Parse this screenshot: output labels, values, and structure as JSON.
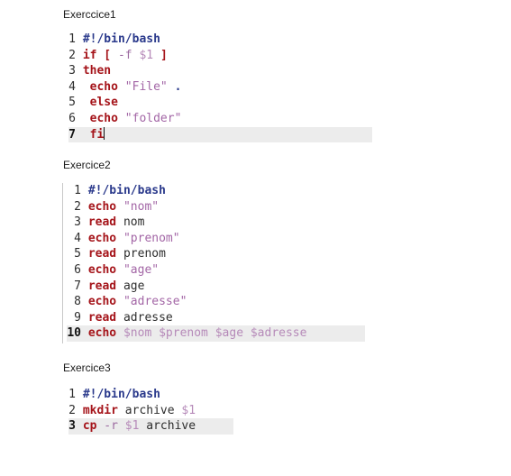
{
  "ex1": {
    "title": "Exerccice1",
    "lines": [
      {
        "n": "1",
        "tokens": [
          {
            "t": "she",
            "v": "#!/bin/bash"
          }
        ]
      },
      {
        "n": "2",
        "tokens": [
          {
            "t": "kw",
            "v": "if ["
          },
          {
            "t": "opt",
            "v": " -f "
          },
          {
            "t": "var",
            "v": "$1 "
          },
          {
            "t": "kw",
            "v": "]"
          }
        ]
      },
      {
        "n": "3",
        "tokens": [
          {
            "t": "kw",
            "v": "then"
          }
        ]
      },
      {
        "n": "4",
        "tokens": [
          {
            "t": "txt",
            "v": " "
          },
          {
            "t": "kw",
            "v": "echo"
          },
          {
            "t": "txt",
            "v": " "
          },
          {
            "t": "str",
            "v": "\"File\""
          },
          {
            "t": "txt",
            "v": " "
          },
          {
            "t": "dot",
            "v": "."
          }
        ]
      },
      {
        "n": "5",
        "tokens": [
          {
            "t": "txt",
            "v": " "
          },
          {
            "t": "kw",
            "v": "else"
          }
        ]
      },
      {
        "n": "6",
        "tokens": [
          {
            "t": "txt",
            "v": " "
          },
          {
            "t": "kw",
            "v": "echo"
          },
          {
            "t": "txt",
            "v": " "
          },
          {
            "t": "str",
            "v": "\"folder\""
          }
        ]
      },
      {
        "n": "7",
        "tokens": [
          {
            "t": "txt",
            "v": " "
          },
          {
            "t": "kw",
            "v": "fi"
          }
        ],
        "current": true,
        "caret": true
      }
    ]
  },
  "ex2": {
    "title": "Exercice2",
    "lines": [
      {
        "n": "1",
        "tokens": [
          {
            "t": "she",
            "v": "#!/bin/bash"
          }
        ]
      },
      {
        "n": "2",
        "tokens": [
          {
            "t": "kw",
            "v": "echo"
          },
          {
            "t": "txt",
            "v": " "
          },
          {
            "t": "str",
            "v": "\"nom\""
          }
        ]
      },
      {
        "n": "3",
        "tokens": [
          {
            "t": "kw",
            "v": "read"
          },
          {
            "t": "txt",
            "v": " nom"
          }
        ]
      },
      {
        "n": "4",
        "tokens": [
          {
            "t": "kw",
            "v": "echo"
          },
          {
            "t": "txt",
            "v": " "
          },
          {
            "t": "str",
            "v": "\"prenom\""
          }
        ]
      },
      {
        "n": "5",
        "tokens": [
          {
            "t": "kw",
            "v": "read"
          },
          {
            "t": "txt",
            "v": " prenom"
          }
        ]
      },
      {
        "n": "6",
        "tokens": [
          {
            "t": "kw",
            "v": "echo"
          },
          {
            "t": "txt",
            "v": " "
          },
          {
            "t": "str",
            "v": "\"age\""
          }
        ]
      },
      {
        "n": "7",
        "tokens": [
          {
            "t": "kw",
            "v": "read"
          },
          {
            "t": "txt",
            "v": " age"
          }
        ]
      },
      {
        "n": "8",
        "tokens": [
          {
            "t": "kw",
            "v": "echo"
          },
          {
            "t": "txt",
            "v": " "
          },
          {
            "t": "str",
            "v": "\"adresse\""
          }
        ]
      },
      {
        "n": "9",
        "tokens": [
          {
            "t": "kw",
            "v": "read"
          },
          {
            "t": "txt",
            "v": " adresse"
          }
        ]
      },
      {
        "n": "10",
        "tokens": [
          {
            "t": "kw",
            "v": "echo"
          },
          {
            "t": "txt",
            "v": " "
          },
          {
            "t": "var",
            "v": "$nom $prenom $age $adresse"
          }
        ],
        "current": true
      }
    ]
  },
  "ex3": {
    "title": "Exercice3",
    "lines": [
      {
        "n": "1",
        "tokens": [
          {
            "t": "she",
            "v": "#!/bin/bash"
          }
        ]
      },
      {
        "n": "2",
        "tokens": [
          {
            "t": "kw",
            "v": "mkdir"
          },
          {
            "t": "txt",
            "v": " archive "
          },
          {
            "t": "var",
            "v": "$1"
          }
        ]
      },
      {
        "n": "3",
        "tokens": [
          {
            "t": "kw",
            "v": "cp"
          },
          {
            "t": "opt",
            "v": " -r "
          },
          {
            "t": "var",
            "v": "$1"
          },
          {
            "t": "txt",
            "v": " archive"
          }
        ],
        "current": true
      }
    ]
  }
}
